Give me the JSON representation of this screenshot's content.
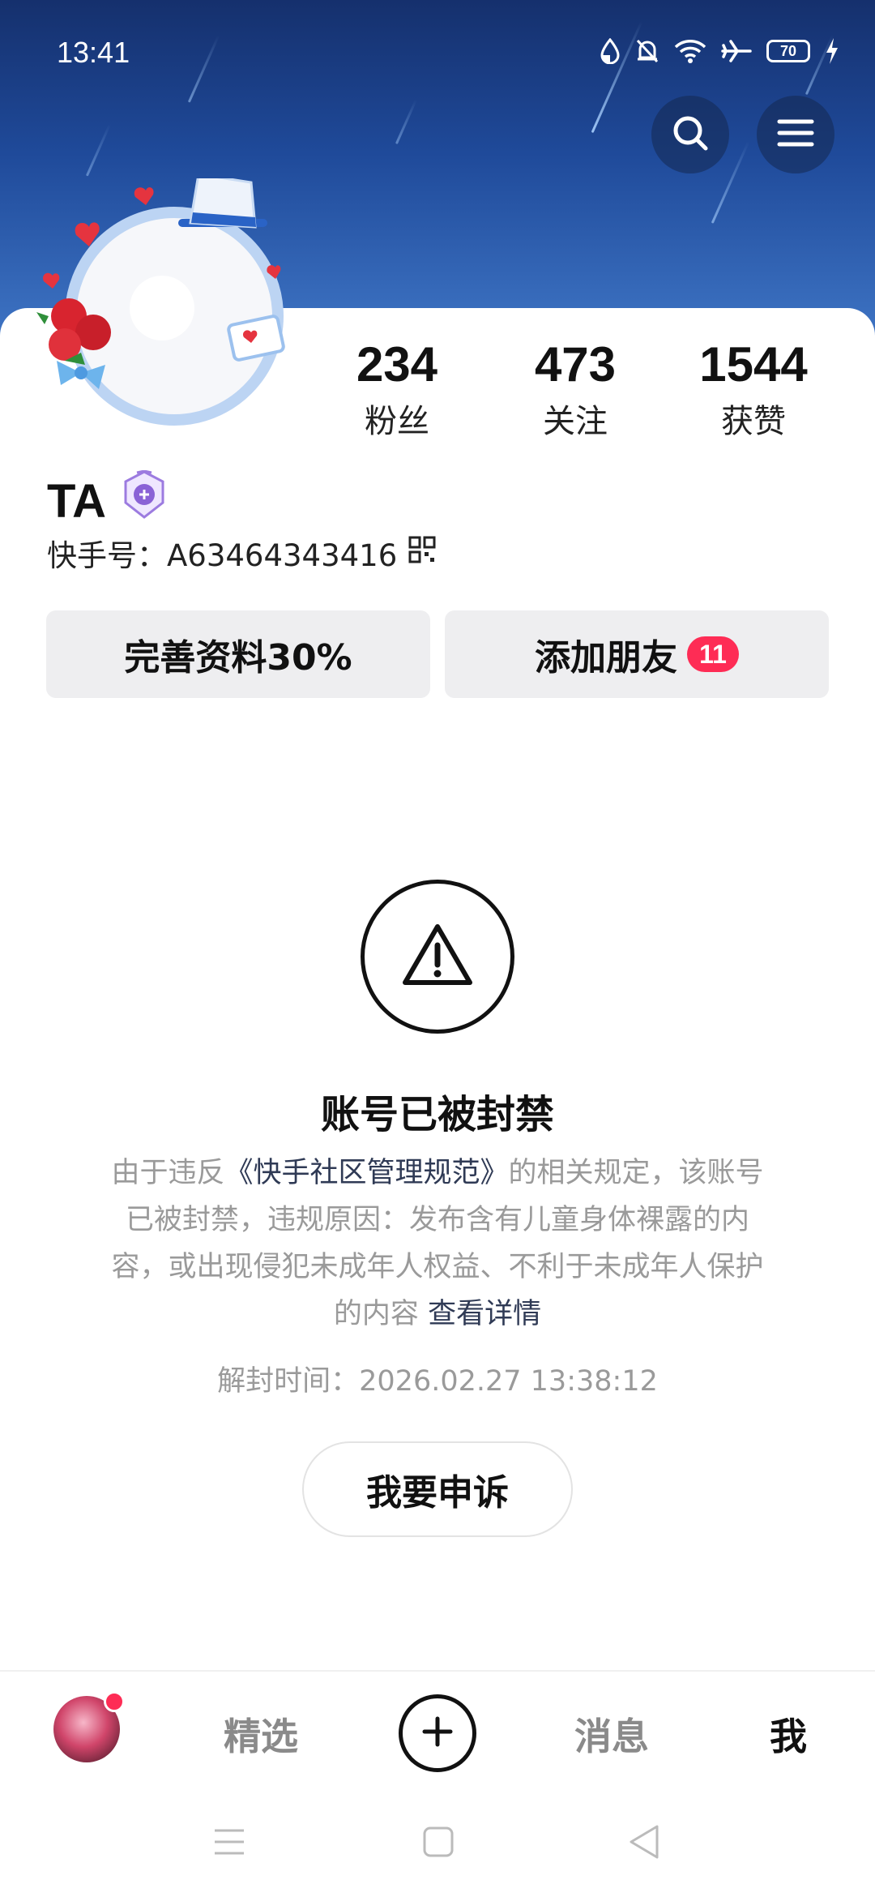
{
  "status_bar": {
    "time": "13:41",
    "battery": "70",
    "icons": [
      "data-saver-icon",
      "mute-icon",
      "wifi-icon",
      "airplane-icon",
      "battery-icon",
      "charging-icon"
    ]
  },
  "header": {
    "search_icon": "search-icon",
    "menu_icon": "menu-icon"
  },
  "profile": {
    "stats": [
      {
        "value": "234",
        "label": "粉丝"
      },
      {
        "value": "473",
        "label": "关注"
      },
      {
        "value": "1544",
        "label": "获赞"
      }
    ],
    "name": "TA",
    "id_text": "快手号：A63464343416",
    "complete_profile": "完善资料30%",
    "add_friends": "添加朋友",
    "add_friends_badge": "11"
  },
  "ban": {
    "title": "账号已被封禁",
    "desc_prefix": "由于违反",
    "desc_link": "《快手社区管理规范》",
    "desc_middle": "的相关规定，该账号已被封禁，违规原因：发布含有儿童身体裸露的内容，或出现侵犯未成年人权益、不利于未成年人保护的内容",
    "details_link": "查看详情",
    "unban_time": "解封时间：2026.02.27 13:38:12",
    "appeal_button": "我要申诉"
  },
  "bottom_nav": {
    "featured": "精选",
    "messages": "消息",
    "me": "我"
  },
  "colors": {
    "accent": "#fe2c55",
    "hero_top": "#15306d",
    "hero_bottom": "#3e74c4",
    "muted_text": "#9a9a9a"
  }
}
